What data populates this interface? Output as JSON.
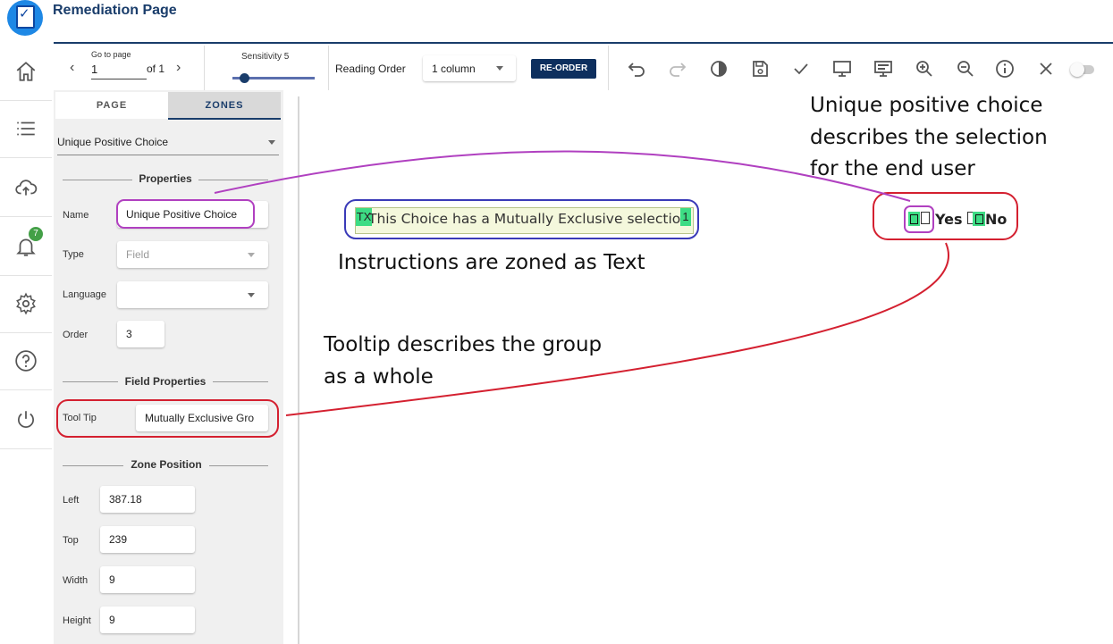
{
  "app": {
    "title": "Remediation Page"
  },
  "nav": {
    "notification_count": "7"
  },
  "toolbar": {
    "goto_label": "Go to page",
    "page_value": "1",
    "page_of": "of 1",
    "sensitivity_label": "Sensitivity 5",
    "sensitivity_value": 0.5,
    "reading_order_label": "Reading Order",
    "reading_order_value": "1 column",
    "reorder_button": "RE-ORDER"
  },
  "panel": {
    "tabs": [
      "PAGE",
      "ZONES"
    ],
    "active_tab": "ZONES",
    "zone_type": "Unique Positive Choice",
    "properties_title": "Properties",
    "name_label": "Name",
    "name_value": "Unique Positive Choice",
    "type_label": "Type",
    "type_placeholder": "Field",
    "language_label": "Language",
    "language_value": "",
    "order_label": "Order",
    "order_value": "3",
    "field_props_title": "Field Properties",
    "tooltip_label": "Tool Tip",
    "tooltip_value": "Mutually Exclusive Gro",
    "zone_pos_title": "Zone Position",
    "left_label": "Left",
    "left_value": "387.18",
    "top_label": "Top",
    "top_value": "239",
    "width_label": "Width",
    "width_value": "9",
    "height_label": "Height",
    "height_value": "9"
  },
  "canvas": {
    "text_zone_tag": "TX",
    "text_zone_text": "This Choice has a Mutually Exclusive selectio",
    "text_zone_order": "1",
    "choice_yes": "Yes",
    "choice_no": "No"
  },
  "annotations": {
    "choice_note_1": "Unique positive choice",
    "choice_note_2": "describes the selection",
    "choice_note_3": "for the end user",
    "instructions_note": "Instructions are zoned as Text",
    "tooltip_note_1": "Tooltip describes the group",
    "tooltip_note_2": "as a whole"
  },
  "colors": {
    "brand": "#1a3d6b",
    "annotation_purple": "#b040c0",
    "annotation_red": "#d42030",
    "annotation_blue": "#3a3ab8",
    "zone_green": "#3ddc84"
  }
}
